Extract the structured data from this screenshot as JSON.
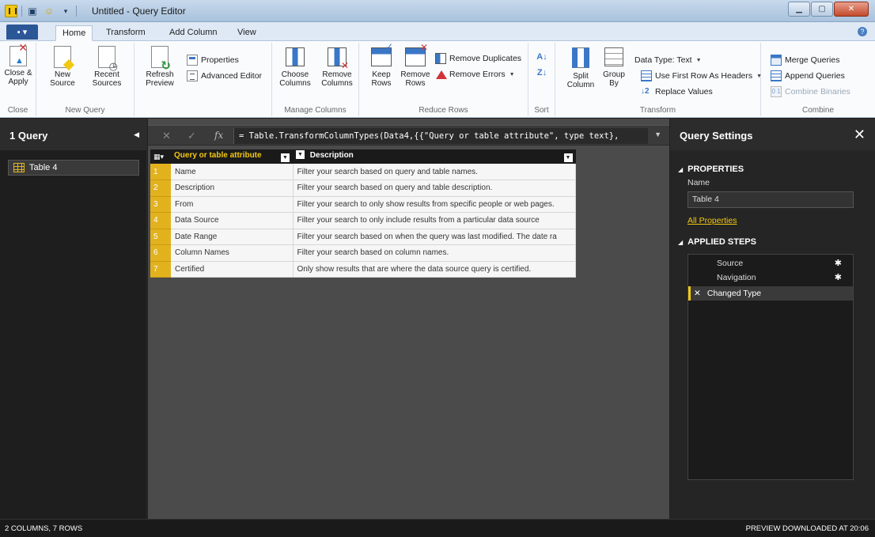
{
  "window": {
    "title": "Untitled - Query Editor"
  },
  "ribbon_tabs": {
    "file": "▪ ▾",
    "tabs": [
      "Home",
      "Transform",
      "Add Column",
      "View"
    ],
    "active": "Home"
  },
  "ribbon": {
    "close_group": {
      "label": "Close",
      "close_apply": "Close & Apply",
      "caret": "▾"
    },
    "new_query_group": {
      "label": "New Query",
      "new_source": "New Source",
      "recent_sources": "Recent Sources"
    },
    "query_group": {
      "refresh_preview": "Refresh Preview",
      "properties": "Properties",
      "advanced_editor": "Advanced Editor"
    },
    "manage_columns_group": {
      "label": "Manage Columns",
      "choose_columns": "Choose Columns",
      "remove_columns": "Remove Columns"
    },
    "reduce_rows_group": {
      "label": "Reduce Rows",
      "keep_rows": "Keep Rows",
      "remove_rows": "Remove Rows",
      "remove_duplicates": "Remove Duplicates",
      "remove_errors": "Remove Errors"
    },
    "sort_group": {
      "label": "Sort",
      "asc": "A↓",
      "desc": "Z↓"
    },
    "transform_group": {
      "label": "Transform",
      "split_column": "Split Column",
      "group_by": "Group By",
      "data_type": "Data Type: Text",
      "first_row_headers": "Use First Row As Headers",
      "replace_values": "Replace Values"
    },
    "combine_group": {
      "label": "Combine",
      "merge_queries": "Merge Queries",
      "append_queries": "Append Queries",
      "combine_binaries": "Combine Binaries"
    }
  },
  "queries_pane": {
    "title": "1 Query",
    "items": [
      {
        "label": "Table 4"
      }
    ]
  },
  "formula_bar": {
    "formula": "= Table.TransformColumnTypes(Data4,{{\"Query or table attribute\", type text},"
  },
  "table": {
    "columns": [
      "Query or table attribute",
      "Description"
    ],
    "rows": [
      {
        "n": "1",
        "attr": "Name",
        "desc": "Filter your search based on query and table names."
      },
      {
        "n": "2",
        "attr": "Description",
        "desc": "Filter your search based on query and table description."
      },
      {
        "n": "3",
        "attr": "From",
        "desc": "Filter your search to only show results from specific people or web pages."
      },
      {
        "n": "4",
        "attr": "Data Source",
        "desc": "Filter your search to only include results from a particular data source"
      },
      {
        "n": "5",
        "attr": "Date Range",
        "desc": "Filter your search based on when the query was last modified. The date ra"
      },
      {
        "n": "6",
        "attr": "Column Names",
        "desc": "Filter your search based on column names."
      },
      {
        "n": "7",
        "attr": "Certified",
        "desc": "Only show results that are where the data source query is certified."
      }
    ]
  },
  "settings": {
    "title": "Query Settings",
    "properties_title": "PROPERTIES",
    "name_label": "Name",
    "name_value": "Table 4",
    "all_properties": "All Properties",
    "applied_steps_title": "APPLIED STEPS",
    "steps": [
      "Source",
      "Navigation",
      "Changed Type"
    ]
  },
  "status": {
    "left": "2 COLUMNS, 7 ROWS",
    "right": "PREVIEW DOWNLOADED AT 20:06"
  },
  "colors": {
    "accent": "#f2c811",
    "ribbon_blue": "#3a77c7",
    "dark_bg": "#1e1e1e"
  }
}
